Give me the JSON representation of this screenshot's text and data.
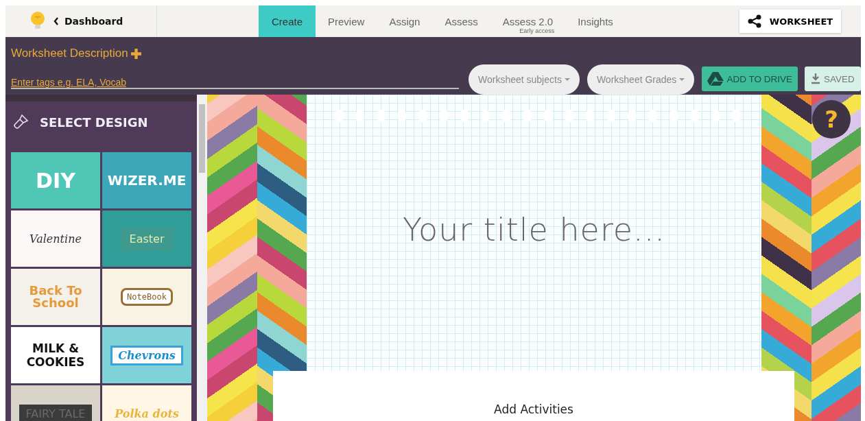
{
  "topbar": {
    "back_link": "Dashboard",
    "share_button": "WORKSHEET"
  },
  "tabs": [
    {
      "label": "Create",
      "selected": true
    },
    {
      "label": "Preview",
      "selected": false
    },
    {
      "label": "Assign",
      "selected": false
    },
    {
      "label": "Assess",
      "selected": false
    },
    {
      "label": "Assess 2.0",
      "sublabel": "Early access",
      "selected": false
    },
    {
      "label": "Insights",
      "selected": false
    }
  ],
  "header": {
    "description_title": "Worksheet Description",
    "tags_placeholder": "Enter tags e.g. ELA, Vocab",
    "subjects_dropdown": "Worksheet subjects",
    "grades_dropdown": "Worksheet Grades",
    "drive_button": "ADD TO DRIVE",
    "saved_button": "SAVED"
  },
  "sidebar": {
    "title": "SELECT DESIGN",
    "designs": [
      {
        "name": "DIY",
        "color": "#4fc6b6"
      },
      {
        "name": "WIZER.ME",
        "color": "#3ba7b8"
      },
      {
        "name": "Valentine",
        "color": "#fbf7f7"
      },
      {
        "name": "Easter",
        "color": "#2f9e98"
      },
      {
        "name": "Back To School",
        "color": "#f3f1ea"
      },
      {
        "name": "NoteBook",
        "color": "#f8f3e2"
      },
      {
        "name": "MILK & COOKIES",
        "color": "#ffffff"
      },
      {
        "name": "Chevrons",
        "color": "#7fd3d8"
      },
      {
        "name": "FAIRY TALE",
        "color": "#d9d4c9"
      },
      {
        "name": "Polka dots",
        "color": "#fff6e6"
      }
    ]
  },
  "canvas": {
    "title": "Your title here...",
    "add_activities": "Add Activities",
    "help_button": "?"
  }
}
